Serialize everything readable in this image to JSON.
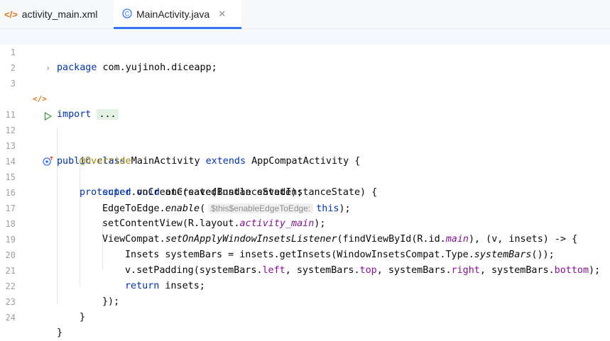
{
  "tabs": [
    {
      "label": "activity_main.xml",
      "icon": "xml-file-icon",
      "active": false
    },
    {
      "label": "MainActivity.java",
      "icon": "java-class-icon",
      "active": true,
      "close": "✕"
    }
  ],
  "colors": {
    "keyword": "#0033b3",
    "annotation": "#9e880d",
    "field": "#871094",
    "accent": "#3574f0"
  },
  "lines": [
    {
      "n": "1"
    },
    {
      "n": "2"
    },
    {
      "n": "3"
    },
    {
      "n": "11"
    },
    {
      "n": "12"
    },
    {
      "n": "13"
    },
    {
      "n": "14"
    },
    {
      "n": "15"
    },
    {
      "n": "16"
    },
    {
      "n": "17"
    },
    {
      "n": "18"
    },
    {
      "n": "19"
    },
    {
      "n": "20"
    },
    {
      "n": "21"
    },
    {
      "n": "22"
    },
    {
      "n": "23"
    },
    {
      "n": "24"
    }
  ],
  "code": {
    "l1_kw": "package",
    "l1_rest": " com.yujinoh.diceapp;",
    "l3_kw": "import",
    "l3_fold": "...",
    "l11_kw1": "public",
    "l11_kw2": "class",
    "l11_name": " MainActivity ",
    "l11_kw3": "extends",
    "l11_rest": " AppCompatActivity {",
    "l13_ann": "@Override",
    "l14_kw1": "protected",
    "l14_kw2": "void",
    "l14_rest": " onCreate(Bundle savedInstanceState) {",
    "l15_kw": "super",
    "l15_rest": ".onCreate(savedInstanceState);",
    "l16_a": "EdgeToEdge.",
    "l16_b": "enable",
    "l16_c": "(",
    "l16_hint": "$this$enableEdgeToEdge:",
    "l16_kw": "this",
    "l16_d": ");",
    "l17_a": "setContentView(R.layout.",
    "l17_b": "activity_main",
    "l17_c": ");",
    "l18_a": "ViewCompat.",
    "l18_b": "setOnApplyWindowInsetsListener",
    "l18_c": "(findViewById(R.id.",
    "l18_d": "main",
    "l18_e": "), (v, insets) -> {",
    "l19_a": "Insets systemBars = insets.getInsets(WindowInsetsCompat.Type.",
    "l19_b": "systemBars",
    "l19_c": "());",
    "l20_a": "v.setPadding(systemBars.",
    "l20_b": "left",
    "l20_c": ", systemBars.",
    "l20_d": "top",
    "l20_e": ", systemBars.",
    "l20_f": "right",
    "l20_g": ", systemBars.",
    "l20_h": "bottom",
    "l20_i": ");",
    "l21_kw": "return",
    "l21_rest": " insets;",
    "l22": "});",
    "l23": "}",
    "l24": "}"
  }
}
